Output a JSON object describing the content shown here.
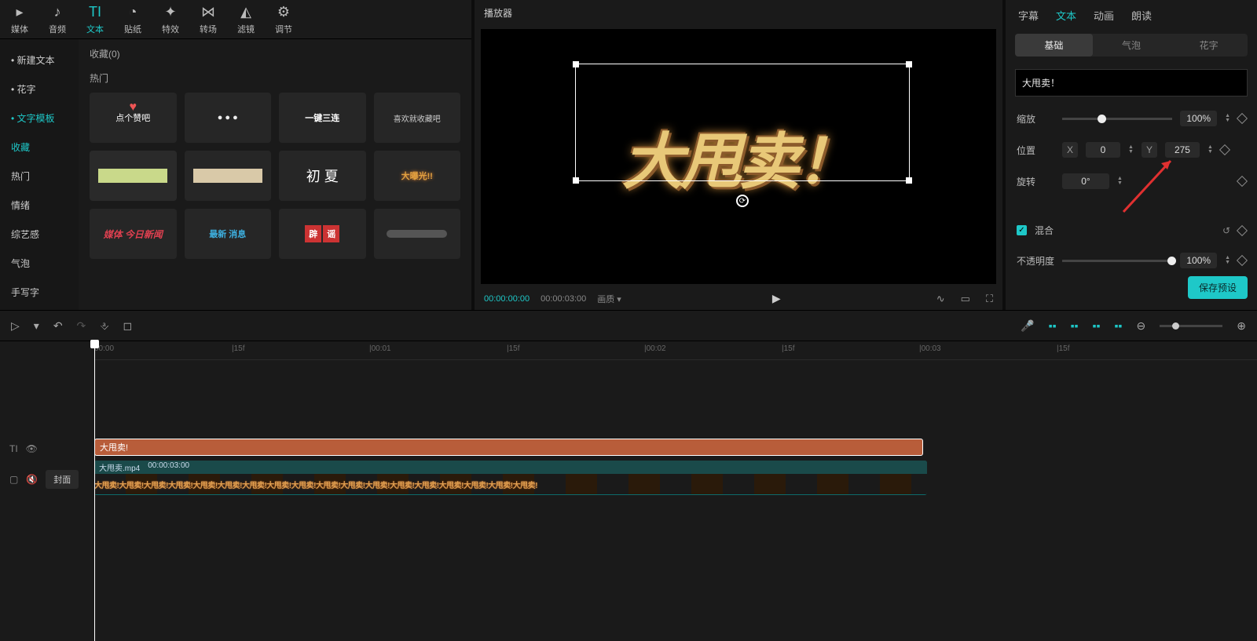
{
  "topTabs": [
    {
      "icon": "▸",
      "label": "媒体"
    },
    {
      "icon": "♪",
      "label": "音频"
    },
    {
      "icon": "TI",
      "label": "文本",
      "active": true
    },
    {
      "icon": "◔",
      "label": "贴纸"
    },
    {
      "icon": "✦",
      "label": "特效"
    },
    {
      "icon": "⋈",
      "label": "转场"
    },
    {
      "icon": "◭",
      "label": "滤镜"
    },
    {
      "icon": "⚙",
      "label": "调节"
    }
  ],
  "sidebar": [
    {
      "label": "• 新建文本"
    },
    {
      "label": "• 花字"
    },
    {
      "label": "• 文字模板",
      "active": true
    },
    {
      "label": "收藏",
      "hl": true
    },
    {
      "label": "热门"
    },
    {
      "label": "情绪"
    },
    {
      "label": "综艺感"
    },
    {
      "label": "气泡"
    },
    {
      "label": "手写字"
    }
  ],
  "templates": {
    "fav": "收藏(0)",
    "hot": "热门",
    "items": [
      "点个赞吧",
      "● ● ●",
      "一键三连",
      "喜欢就收藏吧",
      "",
      "",
      "初\n夏",
      "大曝光!!",
      "媒体 今日新闻",
      "最新 消息",
      "辟 谣",
      ""
    ]
  },
  "preview": {
    "title": "播放器",
    "bigText": "大甩卖！",
    "tcCur": "00:00:00:00",
    "tcDur": "00:00:03:00",
    "quality": "画质"
  },
  "right": {
    "tabs": [
      "字幕",
      "文本",
      "动画",
      "朗读"
    ],
    "activeTab": 1,
    "subs": [
      "基础",
      "气泡",
      "花字"
    ],
    "activeSub": 0,
    "textValue": "大甩卖！",
    "scale": {
      "label": "缩放",
      "value": "100%",
      "pct": 32
    },
    "pos": {
      "label": "位置",
      "x": "0",
      "y": "275"
    },
    "rot": {
      "label": "旋转",
      "value": "0°"
    },
    "mix": {
      "label": "混合"
    },
    "opacity": {
      "label": "不透明度",
      "value": "100%",
      "pct": 100
    },
    "save": "保存预设"
  },
  "timeline": {
    "ruler": [
      {
        "p": 0,
        "t": "00:00"
      },
      {
        "p": 175,
        "t": "|15f"
      },
      {
        "p": 350,
        "t": "|00:01"
      },
      {
        "p": 525,
        "t": "|15f"
      },
      {
        "p": 700,
        "t": "|00:02"
      },
      {
        "p": 875,
        "t": "|15f"
      },
      {
        "p": 1050,
        "t": "|00:03"
      },
      {
        "p": 1225,
        "t": "|15f"
      }
    ],
    "textClip": "大甩卖!",
    "vidName": "大甩卖.mp4",
    "vidDur": "00:00:03:00",
    "frameText": "大甩卖!大甩卖!大甩卖!大甩卖!大甩卖!大甩卖!大甩卖!大甩卖!大甩卖!大甩卖!大甩卖!大甩卖!大甩卖!大甩卖!大甩卖!大甩卖!大甩卖!大甩卖!",
    "cover": "封面"
  }
}
